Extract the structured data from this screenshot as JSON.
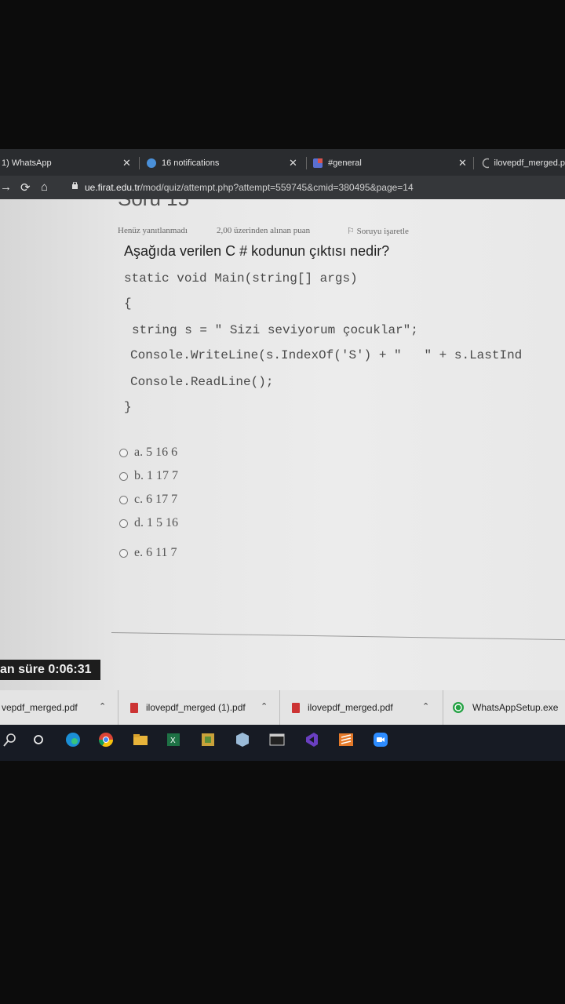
{
  "tabs": [
    {
      "label": "1) WhatsApp"
    },
    {
      "label": "16 notifications"
    },
    {
      "label": "#general"
    },
    {
      "label": "ilovepdf_merged.p"
    }
  ],
  "address": {
    "host": "ue.firat.edu.tr",
    "path": "/mod/quiz/attempt.php?attempt=559745&cmid=380495&page=14"
  },
  "question": {
    "number_label": "Soru 15",
    "status": "Henüz yanıtlanmadı",
    "points": "2,00 üzerinden alınan puan",
    "flag": "Soruyu işaretle",
    "text": "Aşağıda verilen C # kodunun çıktısı nedir?",
    "code_lines": [
      "static void Main(string[] args)",
      "{",
      "string s = \" Sizi seviyorum çocuklar\";",
      "Console.WriteLine(s.IndexOf('S') + \"   \" + s.LastInd",
      "Console.ReadLine();",
      "}"
    ],
    "options": [
      "a. 5 16 6",
      "b. 1 17 7",
      "c. 6 17 7",
      "d. 1 5 16",
      "e. 6 11 7"
    ]
  },
  "timer": {
    "label": "an süre 0:06:31"
  },
  "downloads": [
    {
      "label": "vepdf_merged.pdf"
    },
    {
      "label": "ilovepdf_merged (1).pdf"
    },
    {
      "label": "ilovepdf_merged.pdf"
    },
    {
      "label": "WhatsAppSetup.exe"
    }
  ],
  "colors": {
    "page_bg": "#e9e9e9",
    "tabbar": "#2a2c2f",
    "taskbar": "#171b24",
    "downloads_bar": "#e4e4e4"
  }
}
